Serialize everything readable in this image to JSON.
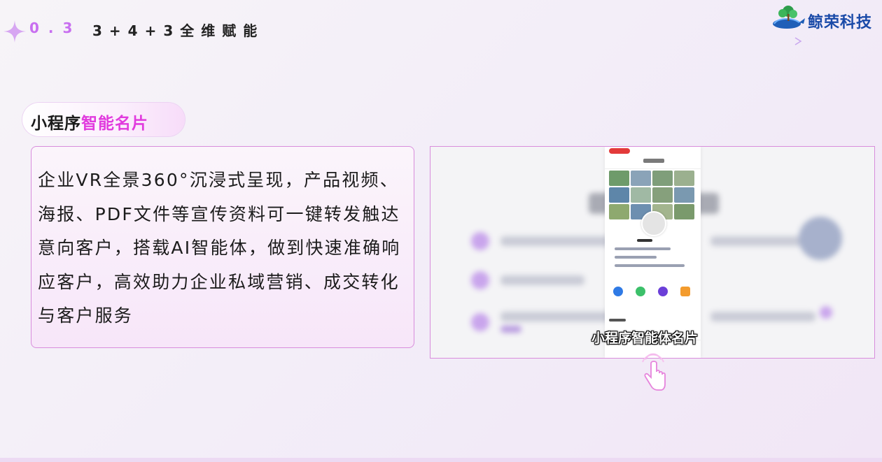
{
  "header": {
    "section_number": "0.3",
    "section_title": "3+4+3全维赋能"
  },
  "brand": {
    "name": "鲸荣科技",
    "logo_icon": "whale-tree-logo-icon"
  },
  "feature": {
    "title_plain": "小程序",
    "title_highlight": "智能名片",
    "description": "企业VR全景360°沉浸式呈现，产品视频、海报、PDF文件等宣传资料可一键转发触达意向客户，搭载AI智能体，做到快速准确响应客户，高效助力企业私域营销、成交转化与客户服务"
  },
  "screenshot": {
    "caption": "小程序智能体名片",
    "pointer_icon": "tap-hand-icon"
  },
  "colors": {
    "accent": "#e13bde",
    "section_number": "#c86ff0",
    "border": "#d88ddc",
    "brand_blue": "#1a4aa8"
  }
}
